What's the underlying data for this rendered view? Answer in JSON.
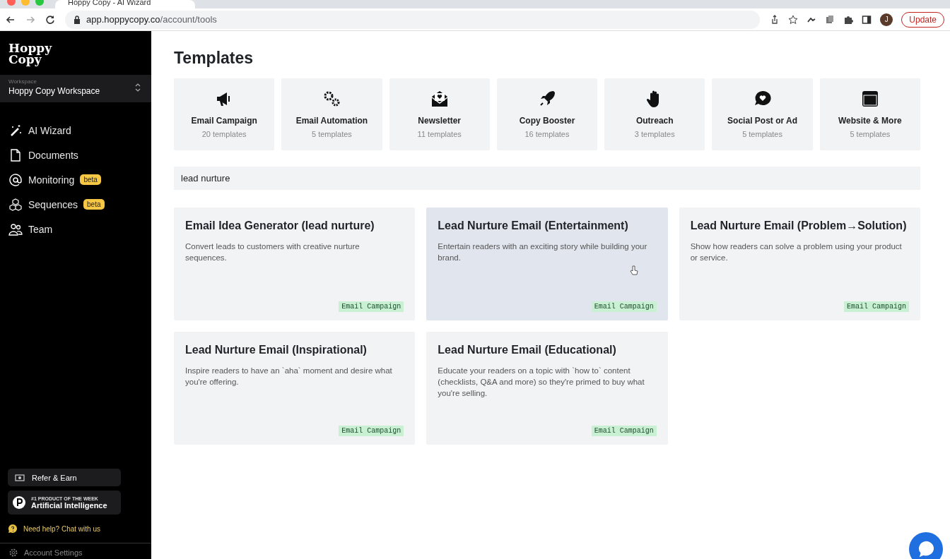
{
  "browser": {
    "tab_title": "Hoppy Copy - AI Wizard",
    "url_host": "app.hoppycopy.co",
    "url_path": "/account/tools",
    "avatar": "J",
    "update_button": "Update"
  },
  "sidebar": {
    "logo": "Hoppy Copy",
    "workspace": {
      "label": "Workspace",
      "value": "Hoppy Copy Workspace"
    },
    "items": [
      {
        "label": "AI Wizard"
      },
      {
        "label": "Documents"
      },
      {
        "label": "Monitoring",
        "badge": "beta"
      },
      {
        "label": "Sequences",
        "badge": "beta"
      },
      {
        "label": "Team"
      }
    ],
    "refer": "Refer & Earn",
    "award": {
      "kicker": "#1 PRODUCT OF THE WEEK",
      "title": "Artificial Intelligence"
    },
    "help": "Need help? Chat with us",
    "account": "Account Settings"
  },
  "main": {
    "title": "Templates",
    "categories": [
      {
        "name": "Email Campaign",
        "count": "20 templates"
      },
      {
        "name": "Email Automation",
        "count": "5 templates"
      },
      {
        "name": "Newsletter",
        "count": "11 templates"
      },
      {
        "name": "Copy Booster",
        "count": "16 templates"
      },
      {
        "name": "Outreach",
        "count": "3 templates"
      },
      {
        "name": "Social Post or Ad",
        "count": "5 templates"
      },
      {
        "name": "Website & More",
        "count": "5 templates"
      }
    ],
    "search": {
      "value": "lead nurture"
    },
    "templates": [
      {
        "title": "Email Idea Generator (lead nurture)",
        "description": "Convert leads to customers with creative nurture sequences.",
        "tag": "Email Campaign",
        "hovered": false
      },
      {
        "title": "Lead Nurture Email (Entertainment)",
        "description": "Entertain readers with an exciting story while building your brand.",
        "tag": "Email Campaign",
        "hovered": true
      },
      {
        "title": "Lead Nurture Email (Problem→Solution)",
        "description": "Show how readers can solve a problem using your product or service.",
        "tag": "Email Campaign",
        "hovered": false
      },
      {
        "title": "Lead Nurture Email (Inspirational)",
        "description": "Inspire readers to have an `aha` moment and desire what you're offering.",
        "tag": "Email Campaign",
        "hovered": false
      },
      {
        "title": "Lead Nurture Email (Educational)",
        "description": "Educate your readers on a topic with `how to` content (checklists, Q&A and more) so they're primed to buy what you're selling.",
        "tag": "Email Campaign",
        "hovered": false
      }
    ]
  }
}
